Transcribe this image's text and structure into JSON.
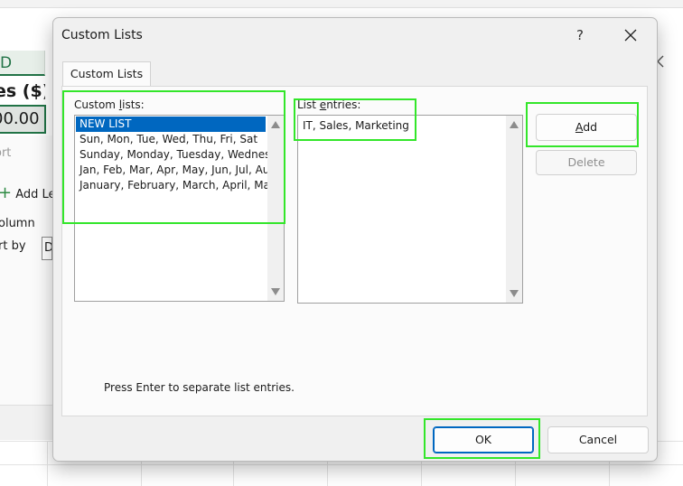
{
  "background": {
    "column_letter": "D",
    "header_fragment": "es ($)",
    "value_fragment": "00.00",
    "sort_fragment": "ort",
    "add_level_fragment": "Add Le",
    "column_fragment": "olumn",
    "sort_by_fragment": "rt by",
    "dropdown_fragment": "D",
    "accent_color": "#217346"
  },
  "dialog": {
    "title": "Custom Lists",
    "help_glyph": "?",
    "tab_label": "Custom Lists",
    "custom_lists_label_pre": "Custom ",
    "custom_lists_label_key": "l",
    "custom_lists_label_post": "ists:",
    "custom_lists": [
      "NEW LIST",
      "Sun, Mon, Tue, Wed, Thu, Fri, Sat",
      "Sunday, Monday, Tuesday, Wednesday, Thursday, Friday, Saturday",
      "Jan, Feb, Mar, Apr, May, Jun, Jul, Aug, Sep, Oct, Nov, Dec",
      "January, February, March, April, May, June, July, August, September, October, November, December"
    ],
    "selected_index": 0,
    "list_entries_label_pre": "List ",
    "list_entries_label_key": "e",
    "list_entries_label_post": "ntries:",
    "list_entries_value": "IT, Sales, Marketing",
    "add_button_key": "A",
    "add_button_rest": "dd",
    "delete_button": "Delete",
    "hint": "Press Enter to separate list entries.",
    "ok_button": "OK",
    "cancel_button": "Cancel",
    "selection_color": "#0067c0",
    "highlight_color": "#33e62a"
  }
}
